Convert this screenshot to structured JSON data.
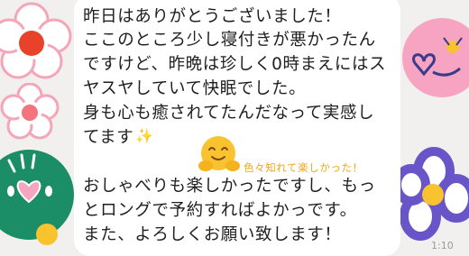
{
  "message": {
    "lines": [
      "昨日はありがとうございました！",
      "ここのところ少し寝付きが悪かったん",
      "ですけど、昨晩は珍しく0時まえにはス",
      "ヤスヤしていて快眠でした。",
      "身も心も癒されてたんだなって実感し",
      "てます",
      "おしゃべりも楽しかったですし、もっ",
      "とロングで予約すればよかっです。",
      "また、よろしくお願い致します！"
    ],
    "sparkle": "✨",
    "hug_emoji": "🤗"
  },
  "handwritten_note": "色々知れて楽しかった！",
  "timestamp": "1:10",
  "colors": {
    "background": "#f1f0ef",
    "bubble": "#ffffff",
    "note": "#f3a713",
    "flower_red": "#e8422a",
    "flower_pink": "#f6a6c0",
    "face_green": "#1b8e68",
    "face_pink": "#f7a4c2",
    "flower_purple": "#6a55c8",
    "emoji_yellow": "#f8c32e"
  },
  "icons": [
    "red-flower-icon",
    "pink-flower-icon",
    "green-smiley-icon",
    "pink-face-sticker-icon",
    "purple-flower-icon",
    "hug-emoji-icon",
    "sparkle-icon"
  ]
}
